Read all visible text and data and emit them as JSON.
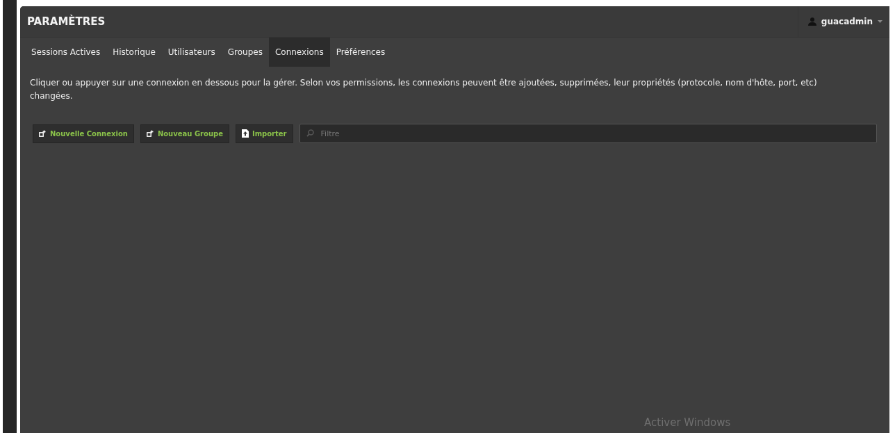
{
  "header": {
    "title": "PARAMÈTRES",
    "user_menu": {
      "label": "guacadmin"
    }
  },
  "tabs": [
    {
      "label": "Sessions Actives",
      "selected": false
    },
    {
      "label": "Historique",
      "selected": false
    },
    {
      "label": "Utilisateurs",
      "selected": false
    },
    {
      "label": "Groupes",
      "selected": false
    },
    {
      "label": "Connexions",
      "selected": true
    },
    {
      "label": "Préférences",
      "selected": false
    }
  ],
  "description": "Cliquer ou appuyer sur une connexion en dessous pour la gérer. Selon vos permissions, les connexions peuvent être ajoutées, supprimées, leur propriétés (protocole, nom d'hôte, port, etc) changées.",
  "actions": [
    {
      "label": "Nouvelle Connexion",
      "kind": "add"
    },
    {
      "label": "Nouveau Groupe",
      "kind": "add"
    },
    {
      "label": "Importer",
      "kind": "import"
    }
  ],
  "filter": {
    "placeholder": "Filtre"
  },
  "os_notice": "Activer Windows"
}
